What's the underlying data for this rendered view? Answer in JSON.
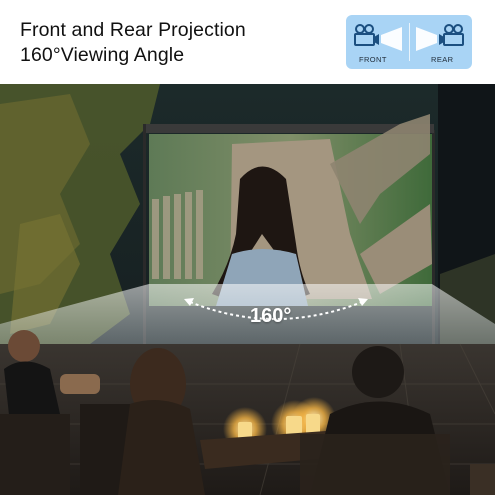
{
  "header": {
    "title_line1": "Front and Rear Projection",
    "title_line2": "160°Viewing Angle"
  },
  "badge": {
    "front_label": "FRONT",
    "rear_label": "REAR",
    "color": "#a9d4f5",
    "icon_color": "#1b4f80"
  },
  "projection": {
    "angle_label": "160°"
  },
  "icons": [
    "projector-front-icon",
    "projector-rear-icon",
    "angle-arc-arrow-icon"
  ]
}
